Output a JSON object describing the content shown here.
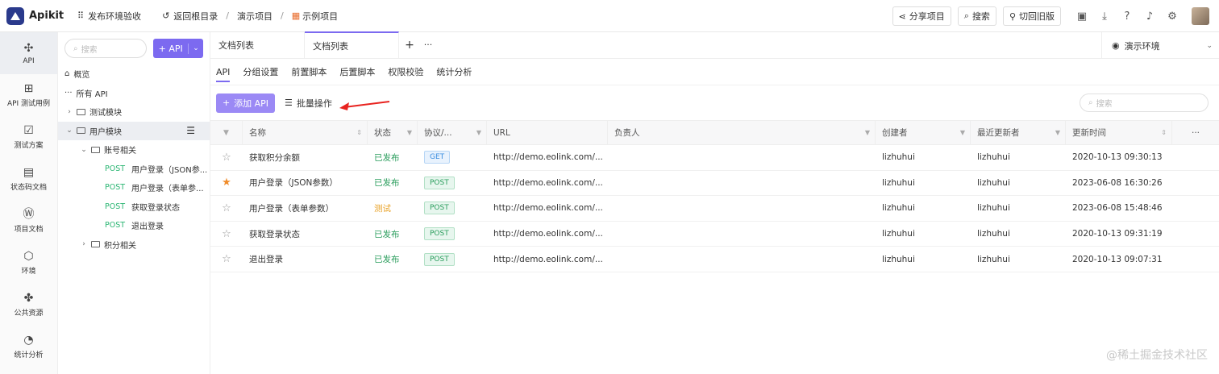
{
  "app": {
    "name": "Apikit"
  },
  "topbar": {
    "workspace": "发布环境验收",
    "back": "返回根目录",
    "crumb1": "演示项目",
    "crumb2": "示例项目",
    "share": "分享项目",
    "search": "搜索",
    "old": "切回旧版"
  },
  "leftnav": [
    {
      "label": "API",
      "icon": "api-icon",
      "glyph": "✣"
    },
    {
      "label": "API 测试用例",
      "icon": "test-case-icon",
      "glyph": "⊞"
    },
    {
      "label": "测试方案",
      "icon": "test-plan-icon",
      "glyph": "☑"
    },
    {
      "label": "状态码文档",
      "icon": "status-doc-icon",
      "glyph": "▤"
    },
    {
      "label": "项目文档",
      "icon": "project-doc-icon",
      "glyph": "Ⓦ"
    },
    {
      "label": "环境",
      "icon": "environment-icon",
      "glyph": "⬡"
    },
    {
      "label": "公共资源",
      "icon": "puzzle-icon",
      "glyph": "✤"
    },
    {
      "label": "统计分析",
      "icon": "chart-icon",
      "glyph": "◔"
    }
  ],
  "tree": {
    "search_placeholder": "搜索",
    "add_button": "+ API",
    "overview": "概览",
    "all_api": "所有 API",
    "items": [
      {
        "label": "测试模块"
      },
      {
        "label": "用户模块"
      },
      {
        "label": "账号相关"
      },
      {
        "method": "POST",
        "label": "用户登录（JSON参..."
      },
      {
        "method": "POST",
        "label": "用户登录（表单参..."
      },
      {
        "method": "POST",
        "label": "获取登录状态"
      },
      {
        "method": "POST",
        "label": "退出登录"
      },
      {
        "label": "积分相关"
      }
    ]
  },
  "tabs": {
    "items": [
      "文档列表",
      "文档列表"
    ],
    "env": "演示环境"
  },
  "subtabs": [
    "API",
    "分组设置",
    "前置脚本",
    "后置脚本",
    "权限校验",
    "统计分析"
  ],
  "toolbar": {
    "add": "添加 API",
    "batch": "批量操作",
    "search_placeholder": "搜索"
  },
  "table": {
    "headers": {
      "name": "名称",
      "status": "状态",
      "protocol": "协议/...",
      "url": "URL",
      "owner": "负责人",
      "creator": "创建者",
      "updater": "最近更新者",
      "time": "更新时间"
    },
    "rows": [
      {
        "starred": false,
        "name": "获取积分余额",
        "status": "已发布",
        "status_type": "pub",
        "method": "GET",
        "url": "http://demo.eolink.com/...",
        "owner": "",
        "creator": "lizhuhui",
        "updater": "lizhuhui",
        "time": "2020-10-13 09:30:13"
      },
      {
        "starred": true,
        "name": "用户登录（JSON参数）",
        "status": "已发布",
        "status_type": "pub",
        "method": "POST",
        "url": "http://demo.eolink.com/...",
        "owner": "",
        "creator": "lizhuhui",
        "updater": "lizhuhui",
        "time": "2023-06-08 16:30:26"
      },
      {
        "starred": false,
        "name": "用户登录（表单参数）",
        "status": "测试",
        "status_type": "test",
        "method": "POST",
        "url": "http://demo.eolink.com/...",
        "owner": "",
        "creator": "lizhuhui",
        "updater": "lizhuhui",
        "time": "2023-06-08 15:48:46"
      },
      {
        "starred": false,
        "name": "获取登录状态",
        "status": "已发布",
        "status_type": "pub",
        "method": "POST",
        "url": "http://demo.eolink.com/...",
        "owner": "",
        "creator": "lizhuhui",
        "updater": "lizhuhui",
        "time": "2020-10-13 09:31:19"
      },
      {
        "starred": false,
        "name": "退出登录",
        "status": "已发布",
        "status_type": "pub",
        "method": "POST",
        "url": "http://demo.eolink.com/...",
        "owner": "",
        "creator": "lizhuhui",
        "updater": "lizhuhui",
        "time": "2020-10-13 09:07:31"
      }
    ]
  },
  "watermark": "@稀土掘金技术社区",
  "colors": {
    "accent": "#7c6af0",
    "published": "#2a9d5c",
    "testing": "#e8a023",
    "star": "#f08c2a",
    "annotation_arrow": "#e8231f"
  }
}
